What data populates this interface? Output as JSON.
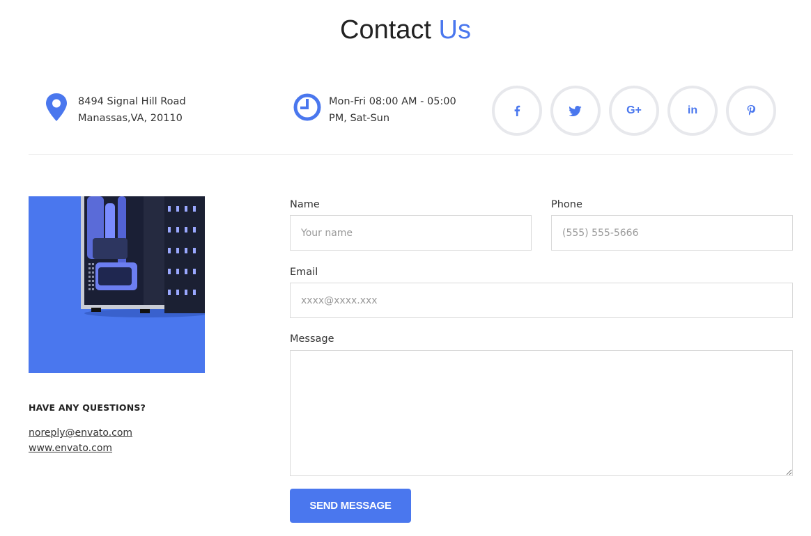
{
  "header": {
    "title_main": "Contact",
    "title_accent": "Us"
  },
  "info": {
    "address": "8494 Signal Hill Road Manassas,VA, 20110",
    "hours": "Mon-Fri 08:00 AM - 05:00 PM, Sat-Sun",
    "address_icon": "map-pin-icon",
    "hours_icon": "clock-icon"
  },
  "social": [
    {
      "name": "facebook",
      "glyph": "f"
    },
    {
      "name": "twitter",
      "glyph": "🐦"
    },
    {
      "name": "google-plus",
      "glyph": "G+"
    },
    {
      "name": "linkedin",
      "glyph": "in"
    },
    {
      "name": "pinterest",
      "glyph": "p"
    }
  ],
  "sidebar": {
    "questions_heading": "HAVE ANY QUESTIONS?",
    "email": "noreply@envato.com",
    "website": "www.envato.com"
  },
  "form": {
    "name_label": "Name",
    "name_placeholder": "Your name",
    "phone_label": "Phone",
    "phone_placeholder": "(555) 555-5666",
    "email_label": "Email",
    "email_placeholder": "xxxx@xxxx.xxx",
    "message_label": "Message",
    "message_value": "",
    "submit_label": "SEND MESSAGE"
  },
  "colors": {
    "accent": "#4a77ee",
    "border": "#d9d9d9",
    "social_ring": "#e7e8ec"
  }
}
